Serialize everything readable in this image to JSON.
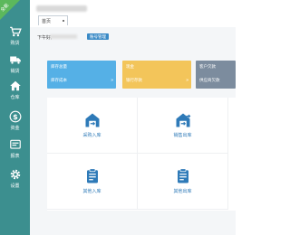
{
  "colors": {
    "sidebar": "#3c8f8f",
    "badge": "#5cb85c",
    "card_blue": "#55b0e6",
    "card_yellow": "#f3c55a",
    "card_gray": "#7c8c9e",
    "accent": "#2e7ab8",
    "button": "#3a8ac6"
  },
  "corner_badge": "全能",
  "sidebar": {
    "items": [
      {
        "label": "购货",
        "icon": "cart-icon"
      },
      {
        "label": "销货",
        "icon": "truck-icon"
      },
      {
        "label": "仓库",
        "icon": "house-icon"
      },
      {
        "label": "资金",
        "icon": "dollar-icon"
      },
      {
        "label": "报表",
        "icon": "report-icon"
      },
      {
        "label": "设置",
        "icon": "gear-icon"
      }
    ]
  },
  "header": {
    "tab_label": "首页"
  },
  "main": {
    "greeting": "下午好,",
    "profile_button": "账号管理",
    "stat_cards": [
      {
        "title": "库存总量",
        "subtitle": "库存成本",
        "arrow": "»",
        "color": "#55b0e6"
      },
      {
        "title": "现金",
        "subtitle": "银行存款",
        "arrow": "»",
        "color": "#f3c55a"
      },
      {
        "title": "客户欠款",
        "subtitle": "供应商欠款",
        "arrow": "",
        "color": "#7c8c9e"
      }
    ],
    "actions": [
      {
        "label": "采购入库",
        "icon": "warehouse-in-icon"
      },
      {
        "label": "销售出库",
        "icon": "warehouse-out-icon"
      },
      {
        "label": "其他入库",
        "icon": "clipboard-in-icon"
      },
      {
        "label": "其他出库",
        "icon": "clipboard-out-icon"
      }
    ]
  }
}
